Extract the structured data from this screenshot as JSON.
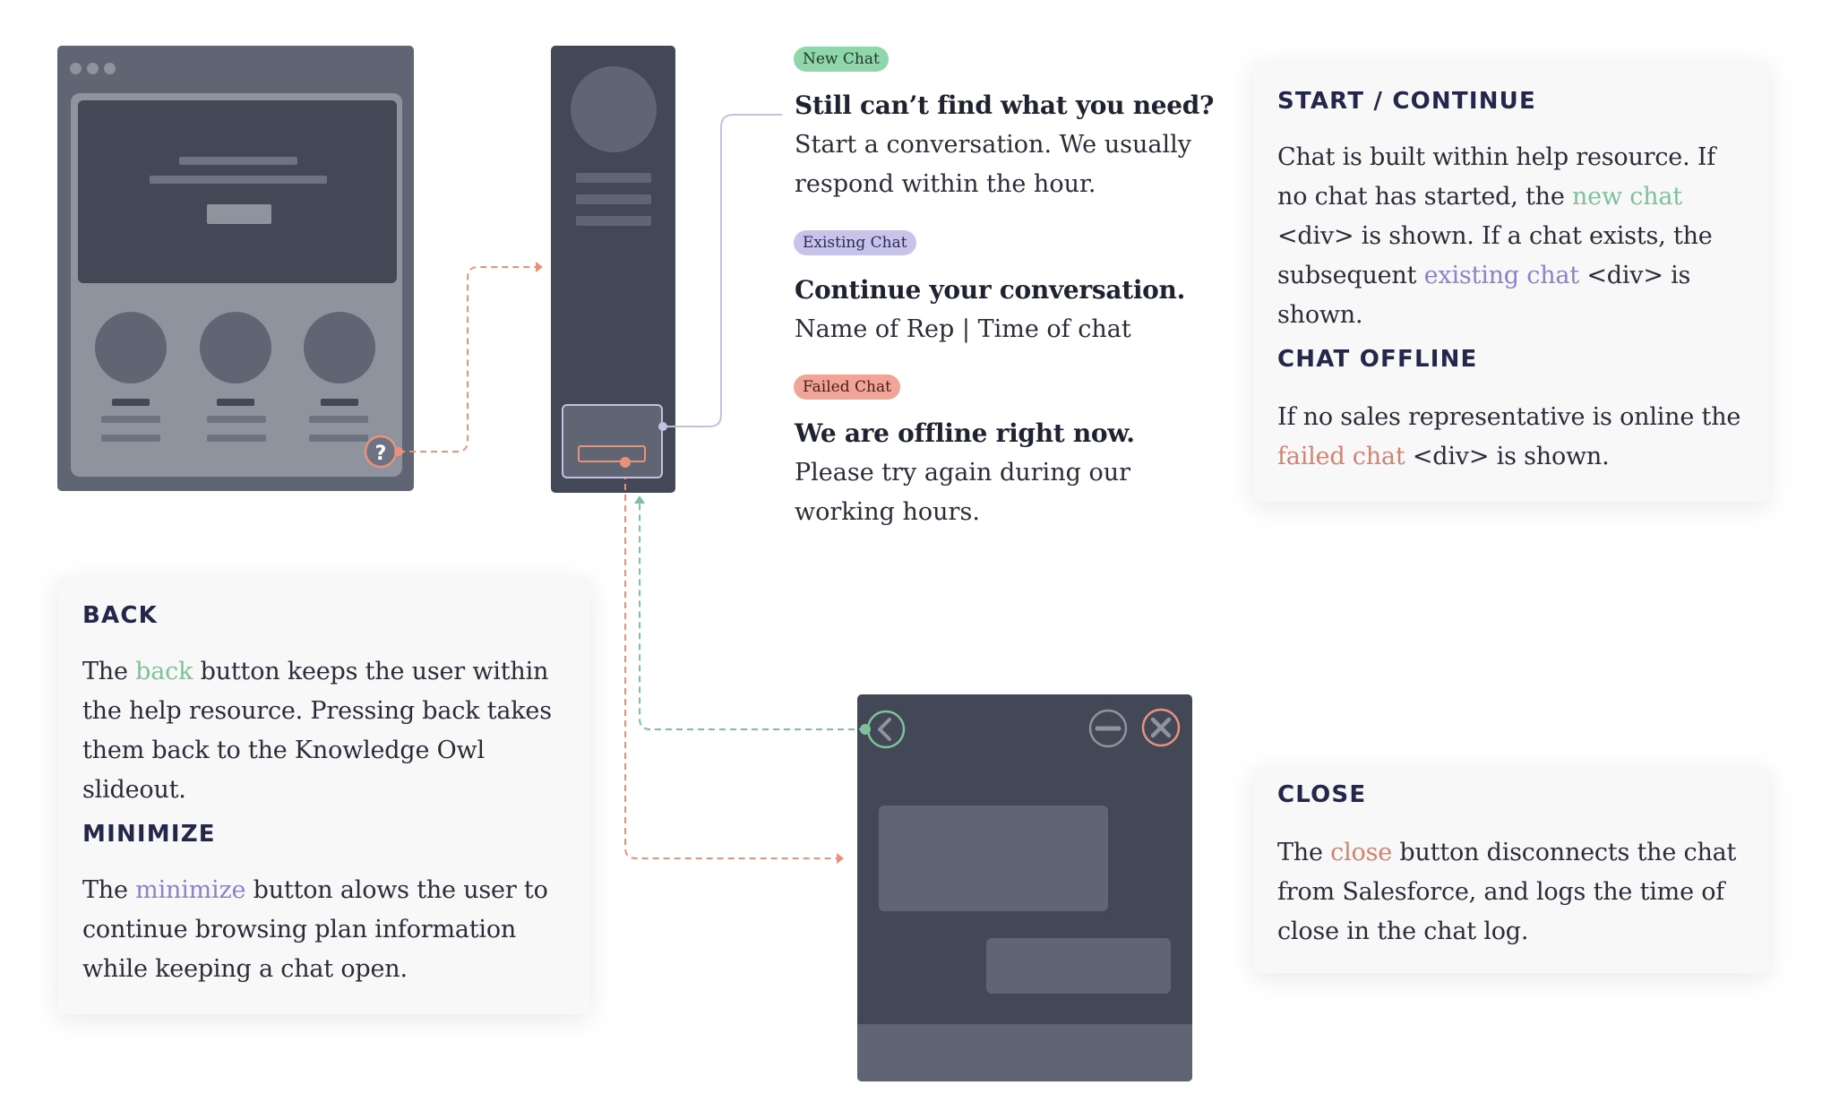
{
  "colors": {
    "dark": "#434856",
    "mid": "#5f6573",
    "light": "#8e939e",
    "green": "#7fc19a",
    "purple": "#8b82c7",
    "salmon": "#e8927c",
    "heading": "#25274a"
  },
  "browser_mock": {
    "help_icon_glyph": "?"
  },
  "chat_window": {
    "back_icon": "chevron-left-icon",
    "minimize_icon": "minus-circle-icon",
    "close_icon": "x-circle-icon"
  },
  "states": [
    {
      "badge": "New Chat",
      "headline": "Still can’t find what you need?",
      "body": "Start a conversation. We usually respond within the hour."
    },
    {
      "badge": "Existing Chat",
      "headline": "Continue your conversation.",
      "body": "Name of Rep | Time of chat"
    },
    {
      "badge": "Failed Chat",
      "headline": "We are offline right now.",
      "body": "Please try again during our working hours."
    }
  ],
  "cards": {
    "start": {
      "title": "START / CONTINUE",
      "t1": "Chat is built within help resource. If no chat has started, the ",
      "h1": "new chat",
      "t2": " <div> is shown. If a chat exists,  the subsequent ",
      "h2": "existing chat",
      "t3": " <div> is shown."
    },
    "offline": {
      "title": "CHAT OFFLINE",
      "t1": "If no sales representative is online the ",
      "h1": "failed chat",
      "t2": " <div> is shown."
    },
    "back": {
      "title": "BACK",
      "t1": "The ",
      "h1": "back",
      "t2": " button keeps the user within the help resource. Pressing back takes them back to the Knowledge Owl slideout."
    },
    "minimize": {
      "title": "MINIMIZE",
      "t1": "The ",
      "h1": "minimize",
      "t2": " button alows the user to continue browsing plan information while keeping a chat open."
    },
    "close": {
      "title": "CLOSE",
      "t1": "The ",
      "h1": "close",
      "t2": " button disconnects the chat from Salesforce, and logs the time of close in the chat log."
    }
  }
}
